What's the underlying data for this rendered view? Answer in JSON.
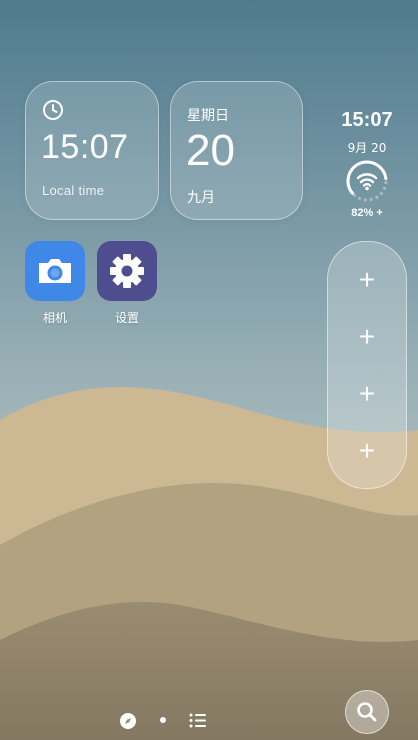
{
  "clock_widget": {
    "time": "15:07",
    "label": "Local time"
  },
  "date_widget": {
    "weekday": "星期日",
    "day": "20",
    "month": "九月"
  },
  "side_info": {
    "time": "15:07",
    "date": "9月 20",
    "battery": "82% +",
    "battery_level": 0.82
  },
  "apps": [
    {
      "label": "相机",
      "icon": "camera-icon"
    },
    {
      "label": "设置",
      "icon": "gear-icon"
    }
  ],
  "add_panel": {
    "buttons": [
      "+",
      "+",
      "+",
      "+"
    ]
  },
  "dock": {
    "left_icon": "compass-icon",
    "page_indicator": "current-page-dot",
    "right_icon": "list-icon"
  },
  "search": {
    "icon": "search-icon"
  },
  "colors": {
    "sky_top": "#4f7b8f",
    "sky_bottom": "#b7c6c7",
    "sand_light": "#ccb893",
    "sand_mid": "#b3a27f",
    "sand_dark": "#8c7f66",
    "camera_bg": "#3f88e8",
    "settings_bg": "#4d4d8f"
  }
}
